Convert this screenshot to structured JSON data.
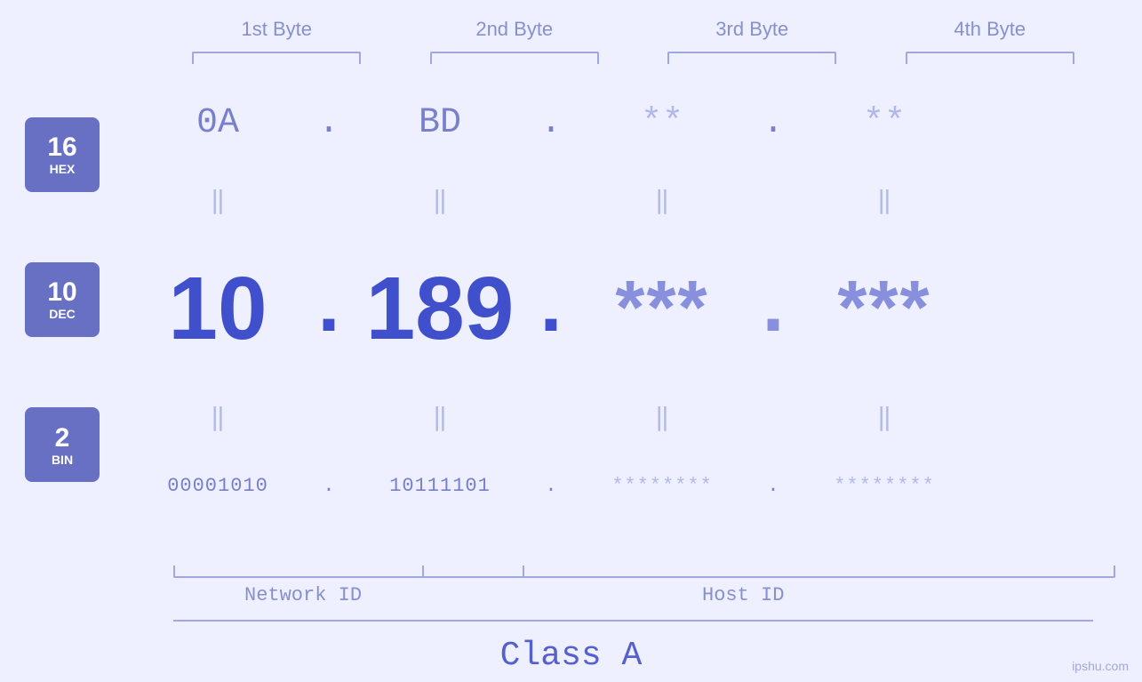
{
  "headers": {
    "byte1": "1st Byte",
    "byte2": "2nd Byte",
    "byte3": "3rd Byte",
    "byte4": "4th Byte"
  },
  "badges": {
    "hex": {
      "num": "16",
      "label": "HEX"
    },
    "dec": {
      "num": "10",
      "label": "DEC"
    },
    "bin": {
      "num": "2",
      "label": "BIN"
    }
  },
  "values": {
    "hex": {
      "b1": "0A",
      "b2": "BD",
      "b3": "**",
      "b4": "**",
      "dot": "."
    },
    "dec": {
      "b1": "10",
      "b2": "189.",
      "b3": "***",
      "b4": "***",
      "dot": "."
    },
    "bin": {
      "b1": "00001010",
      "b2": "10111101",
      "b3": "********",
      "b4": "********",
      "dot": "."
    }
  },
  "labels": {
    "network_id": "Network ID",
    "host_id": "Host ID",
    "class": "Class A"
  },
  "watermark": "ipshu.com"
}
